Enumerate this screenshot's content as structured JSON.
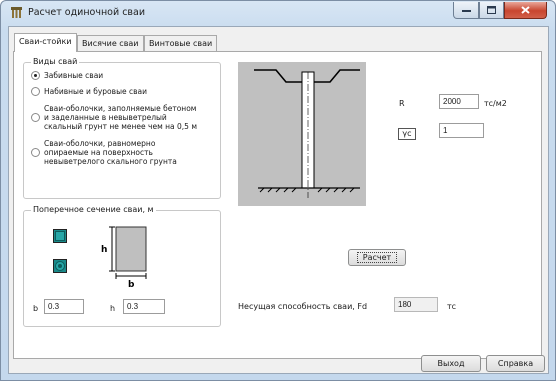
{
  "window": {
    "title": "Расчет одиночной сваи"
  },
  "tabs": [
    {
      "label": "Сваи-стойки",
      "active": true
    },
    {
      "label": "Висячие сваи",
      "active": false
    },
    {
      "label": "Винтовые сваи",
      "active": false
    }
  ],
  "pile_types": {
    "legend": "Виды свай",
    "options": [
      {
        "label": "Забивные сваи",
        "checked": true
      },
      {
        "label": "Набивные и буровые сваи",
        "checked": false
      },
      {
        "label": "Сваи-оболочки, заполняемые бетоном\nи заделанные в невыветрелый\nскальный грунт не менее чем на 0,5 м",
        "checked": false
      },
      {
        "label": "Сваи-оболочки, равномерно\nопираемые на поверхность\nневыветрелого скального грунта",
        "checked": false
      }
    ]
  },
  "cross_section": {
    "legend": "Поперечное сечение сваи, м",
    "diagram_h": "h",
    "diagram_b": "b",
    "b_label": "b",
    "b_value": "0.3",
    "h_label": "h",
    "h_value": "0.3"
  },
  "params": {
    "r_label": "R",
    "r_value": "2000",
    "r_unit": "тс/м2",
    "gamma_label": "γc",
    "gamma_value": "1"
  },
  "actions": {
    "calc_label": "Расчет",
    "exit_label": "Выход",
    "help_label": "Справка"
  },
  "result": {
    "label": "Несущая способность сваи, Fd",
    "value": "180",
    "unit": "тс"
  },
  "colors": {
    "title_bar": "#c9dcef",
    "close_button": "#c8452f",
    "section_square_fill": "#1a8a8a",
    "pile_diagram_bg": "#c0c0c0"
  },
  "icons": {
    "app": "pile-structure-icon",
    "minimize": "minimize-icon",
    "maximize": "maximize-icon",
    "close": "close-icon",
    "square_section": "square-section-icon",
    "round_section": "round-section-icon"
  }
}
